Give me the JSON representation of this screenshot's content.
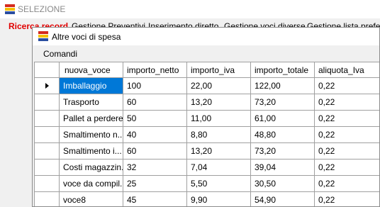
{
  "back_window": {
    "title": "SELEZIONE",
    "menu": [
      "Ricerca record",
      "Gestione Preventivi",
      "Inserimento diretto",
      "Gestione voci diverse",
      "Gestione lista preferiti"
    ]
  },
  "window": {
    "title": "Altre voci di spesa",
    "menu": [
      "Comandi"
    ]
  },
  "grid": {
    "columns": [
      "nuova_voce",
      "importo_netto",
      "importo_iva",
      "importo_totale",
      "aliquota_Iva"
    ],
    "rows": [
      [
        "Imballaggio",
        "100",
        "22,00",
        "122,00",
        "0,22"
      ],
      [
        "Trasporto",
        "60",
        "13,20",
        "73,20",
        "0,22"
      ],
      [
        "Pallet a perdere",
        "50",
        "11,00",
        "61,00",
        "0,22"
      ],
      [
        "Smaltimento n...",
        "40",
        "8,80",
        "48,80",
        "0,22"
      ],
      [
        "Smaltimento i...",
        "60",
        "13,20",
        "73,20",
        "0,22"
      ],
      [
        "Costi magazzin...",
        "32",
        "7,04",
        "39,04",
        "0,22"
      ],
      [
        "voce da compil...",
        "25",
        "5,50",
        "30,50",
        "0,22"
      ],
      [
        "voce8",
        "45",
        "9,90",
        "54,90",
        "0,22"
      ]
    ],
    "current_row": 0
  },
  "colors": {
    "selection": "#0078d7",
    "menu_active": "#e00000",
    "icon_bands": [
      "#d52b1e",
      "#f5c000",
      "#2a4ea0"
    ]
  },
  "icons": {
    "app": "app-flag-icon",
    "row_indicator": "current-row-arrow-icon"
  }
}
